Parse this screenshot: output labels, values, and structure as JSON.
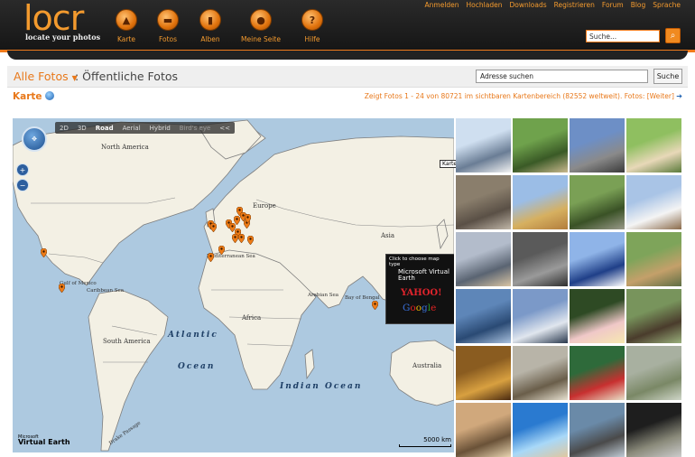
{
  "header": {
    "logo_word": "locr",
    "logo_tagline": "locate your photos",
    "nav": [
      {
        "label": "Karte",
        "icon": "map-icon"
      },
      {
        "label": "Fotos",
        "icon": "camera-icon"
      },
      {
        "label": "Alben",
        "icon": "album-icon"
      },
      {
        "label": "Meine Seite",
        "icon": "user-icon"
      },
      {
        "label": "Hilfe",
        "icon": "help-icon"
      }
    ],
    "top_links": [
      "Anmelden",
      "Hochladen",
      "Downloads",
      "Registrieren",
      "Forum",
      "Blog",
      "Sprache"
    ],
    "search_value": "Suche..."
  },
  "breadcrumb": {
    "dropdown": "Alle Fotos",
    "rest": ": Öffentliche Fotos",
    "address_value": "Adresse suchen",
    "address_button": "Suche"
  },
  "section": {
    "title": "Karte",
    "info_text": "Zeigt Fotos 1 - 24 von 80721 im sichtbaren Kartenbereich (82552 weltweit). Fotos: [Weiter]"
  },
  "map": {
    "modes": [
      {
        "label": "2D",
        "state": "normal"
      },
      {
        "label": "3D",
        "state": "normal"
      },
      {
        "label": "Road",
        "state": "active"
      },
      {
        "label": "Aerial",
        "state": "normal"
      },
      {
        "label": "Hybrid",
        "state": "normal"
      },
      {
        "label": "Bird's eye",
        "state": "disabled"
      },
      {
        "label": "<<",
        "state": "normal"
      }
    ],
    "labels": {
      "north_america": "North America",
      "south_america": "South America",
      "europe": "Europe",
      "asia": "Asia",
      "africa": "Africa",
      "australia": "Australia",
      "gulf_mexico": "Gulf of Mexico",
      "caribbean": "Caribbean Sea",
      "mediterranean": "Mediterranean Sea",
      "arabian": "Arabian Sea",
      "bengal": "Bay of Bengal",
      "drake": "Drake Passage"
    },
    "oceans": {
      "atlantic": "Atlantic",
      "ocean_atlantic": "Ocean",
      "indian": "Indian Ocean"
    },
    "chooser_title": "Click to choose map type",
    "chooser_msve": "Microsoft Virtual Earth",
    "chooser_yahoo": "YAHOO!",
    "chooser_google": "Google",
    "tooltip": "Kartenauswahl",
    "scale": "5000 km",
    "brand_small": "Microsoft",
    "brand_big": "Virtual Earth",
    "colors": {
      "water": "#adc9e0",
      "land": "#f3f0e4",
      "border": "#7e7e7e",
      "pin": "#ee7b16"
    }
  },
  "thumbnails": [
    "snowy-mountain-hut",
    "forest-path",
    "modern-building",
    "palm-houses",
    "city-street-aerial",
    "yellow-palace",
    "statue-garden",
    "white-church",
    "bay-at-dusk",
    "sculpture-wall",
    "catholic-church-sign",
    "village-roofs",
    "sea-horizon",
    "pier-sunset",
    "lotus-flower",
    "wooden-hut",
    "golden-dome",
    "railway-tracks",
    "shop-street",
    "flooded-field",
    "beach-crowd",
    "swimming-pool",
    "river-town",
    "dark-doorway"
  ]
}
